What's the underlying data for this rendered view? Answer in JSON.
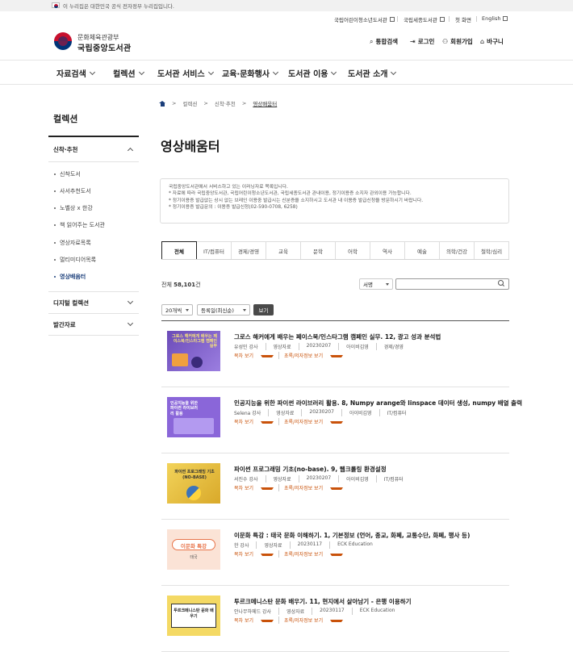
{
  "gov_banner": {
    "text": "이 누리집은 대한민국 공식 전자정부 누리집입니다."
  },
  "util_links": [
    {
      "label": "국립어린이청소년도서관"
    },
    {
      "label": "국립세종도서관"
    },
    {
      "label": "첫 화면"
    },
    {
      "label": "English"
    }
  ],
  "logo": {
    "sub": "문화체육관광부",
    "main": "국립중앙도서관"
  },
  "header_actions": [
    {
      "icon": "search-icon",
      "label": "통합검색"
    },
    {
      "icon": "login-icon",
      "label": "로그인"
    },
    {
      "icon": "user-icon",
      "label": "회원가입"
    },
    {
      "icon": "cart-icon",
      "label": "바구니"
    }
  ],
  "gnb": [
    {
      "label": "자료검색"
    },
    {
      "label": "컬렉션"
    },
    {
      "label": "도서관 서비스"
    },
    {
      "label": "교육·문화행사"
    },
    {
      "label": "도서관 이용"
    },
    {
      "label": "도서관 소개"
    }
  ],
  "sidebar": {
    "title": "컬렉션",
    "section1": "신착·추천",
    "items": [
      {
        "label": "신착도서"
      },
      {
        "label": "사서추천도서"
      },
      {
        "label": "노벨상 x 한강"
      },
      {
        "label": "책 읽어주는 도서관"
      },
      {
        "label": "영상자료목록"
      },
      {
        "label": "멀티미디어목록"
      },
      {
        "label": "영상배움터"
      }
    ],
    "section2": "디지털 컬렉션",
    "section3": "발간자료"
  },
  "breadcrumb": [
    "컬렉션",
    "신착·추천",
    "영상배움터"
  ],
  "page_title": "영상배움터",
  "info_lines": [
    "국립중앙도서관에서 서비스하고 있는 이러닝자료 목록입니다.",
    "* 자료에 따라 국립중앙도서관, 국립어린이청소년도서관, 국립세종도서관 관내이용, 정기이용증 소지자 관외이용 가능합니다.",
    "* 정기이용증 발급없는 상시 없는 브레인 이용중 발급시는 신분증을 소지하시고 도서관 내 이용증 발급신청을 방문하시기 바랍니다.",
    "* 정기이용증 발급문의 : 이용증 발급신청(02-590-0708, 6258)"
  ],
  "tabs": [
    "전체",
    "IT/컴퓨터",
    "경제/경영",
    "교육",
    "문학",
    "어학",
    "역사",
    "예술",
    "의학/건강",
    "철학/심리"
  ],
  "total": {
    "prefix": "전체",
    "count": "58,101",
    "suffix": "건"
  },
  "search": {
    "select": "서명",
    "placeholder": ""
  },
  "filters": {
    "per_page": "20개씩",
    "sort": "등록일(최신순)",
    "view_button": "보기"
  },
  "items": [
    {
      "title": "그로스 해커에게 배우는 페이스북/인스타그램 캠페인 실무. 12, 광고 성과 분석법",
      "meta": [
        "유성민 강사",
        "영상자료",
        "20230207",
        "아이비김영",
        "경제/경영"
      ],
      "links": [
        "목차 보기",
        "초록/저자정보 보기"
      ],
      "thumb_text": "그로스 해커에게 배우는 페이스북/인스타그램 캠페인 실무",
      "colors": {
        "bg": "#7a5fc4"
      }
    },
    {
      "title": "인공지능을 위한 파이썬 라이브러리 활용. 8, Numpy arange와 linspace 데이터 생성, numpy 배열 출력",
      "meta": [
        "Selena 강사",
        "영상자료",
        "20230207",
        "아이비김영",
        "IT/컴퓨터"
      ],
      "links": [
        "목차 보기",
        "초록/저자정보 보기"
      ],
      "thumb_text": "인공지능을 위한 파이썬 라이브러리 활용",
      "colors": {
        "bg": "#8a66d9"
      }
    },
    {
      "title": "파이썬 프로그래밍 기초(no-base). 9, 웹크롤링 환경설정",
      "meta": [
        "서진수 강사",
        "영상자료",
        "20230207",
        "아이비김영",
        "IT/컴퓨터"
      ],
      "links": [
        "목차 보기",
        "초록/저자정보 보기"
      ],
      "thumb_text": "파이썬 프로그래밍 기초 (NO-BASE)",
      "colors": {
        "bg": "#e9c441"
      }
    },
    {
      "title": "이문화 특강 : 태국 문화 이해하기. 1, 기본정보 (언어, 종교, 화폐, 교통수단, 화폐, 행사 등)",
      "meta": [
        "한 강사",
        "영상자료",
        "20230117",
        "ECK Education"
      ],
      "links": [
        "목차 보기",
        "초록/저자정보 보기"
      ],
      "thumb_text": "이문화 특강",
      "thumb_sub": "태국",
      "colors": {
        "bg": "#fbe3d6"
      }
    },
    {
      "title": "투르크메니스탄 문화 배우기. 11, 현지에서 살아남기 - 은행 이용하기",
      "meta": [
        "안나무하메드 강사",
        "영상자료",
        "20230117",
        "ECK Education"
      ],
      "links": [
        "목차 보기",
        "초록/저자정보 보기"
      ],
      "thumb_text": "투르크메니스탄 문화 배우기",
      "colors": {
        "bg": "#f4d964"
      }
    }
  ]
}
